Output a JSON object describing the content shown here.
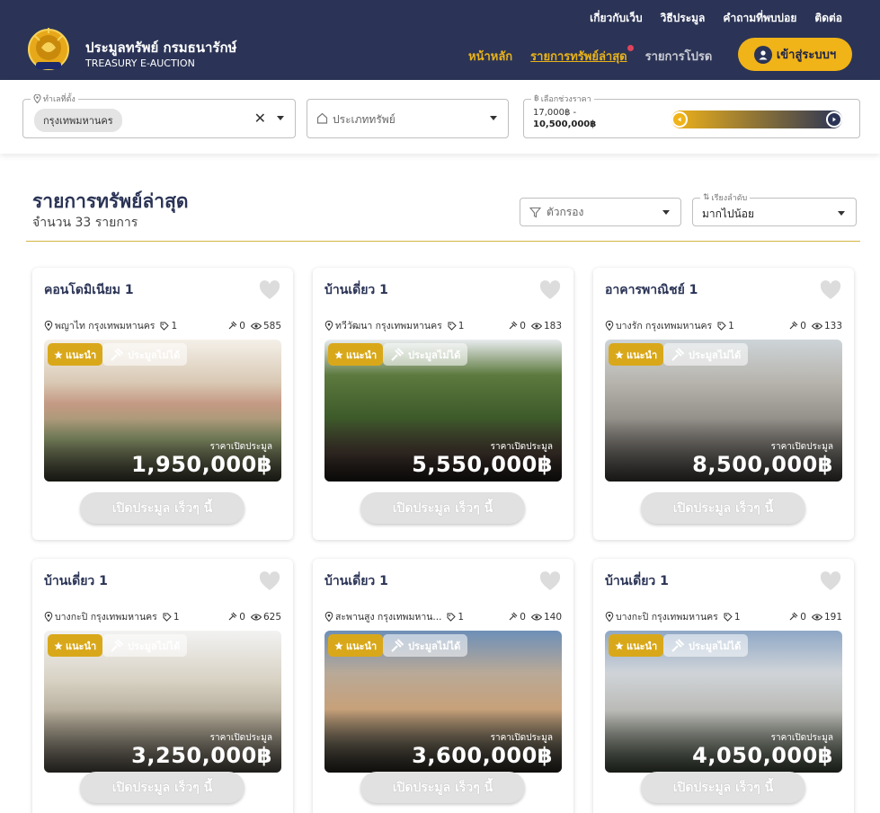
{
  "header": {
    "top_links": [
      "เกี่ยวกับเว็บ",
      "วิธีประมูล",
      "คำถามที่พบบ่อย",
      "ติดต่อ"
    ],
    "brand_th": "ประมูลทรัพย์ กรมธนารักษ์",
    "brand_en": "TREASURY E-AUCTION",
    "nav": {
      "home": "หน้าหลัก",
      "latest": "รายการทรัพย์ล่าสุด",
      "promo": "รายการโปรด"
    },
    "login_label": "เข้าสู่ระบบฯ"
  },
  "filters": {
    "location_legend": "ทำเลที่ตั้ง",
    "location_chip": "กรุงเทพมหานคร",
    "type_placeholder": "ประเภททรัพย์",
    "price_legend": "เลือกช่วงราคา",
    "price_min": "17,000฿ -",
    "price_max": "10,500,000฿"
  },
  "section": {
    "title": "รายการทรัพย์ล่าสุด",
    "count": "จำนวน 33 รายการ",
    "filter_label": "ตัวกรอง",
    "sort_legend": "เรียงลำดับ",
    "sort_value": "มากไปน้อย"
  },
  "badges": {
    "recommended": "แนะนำ",
    "biddable": "ประมูลไม่ได้",
    "price_label": "ราคาเปิดประมูล",
    "cta": "เปิดประมูล เร็วๆ นี้"
  },
  "listings": [
    {
      "title": "คอนโดมิเนียม 1",
      "location": "พญาไท กรุงเทพมหานคร",
      "tag": "1",
      "bids": "0",
      "views": "585",
      "price": "1,950,000฿"
    },
    {
      "title": "บ้านเดี่ยว 1",
      "location": "ทวีวัฒนา กรุงเทพมหานคร",
      "tag": "1",
      "bids": "0",
      "views": "183",
      "price": "5,550,000฿"
    },
    {
      "title": "อาคารพาณิชย์ 1",
      "location": "บางรัก กรุงเทพมหานคร",
      "tag": "1",
      "bids": "0",
      "views": "133",
      "price": "8,500,000฿"
    },
    {
      "title": "บ้านเดี่ยว 1",
      "location": "บางกะปิ กรุงเทพมหานคร",
      "tag": "1",
      "bids": "0",
      "views": "625",
      "price": "3,250,000฿"
    },
    {
      "title": "บ้านเดี่ยว 1",
      "location": "สะพานสูง กรุงเทพมหาน...",
      "tag": "1",
      "bids": "0",
      "views": "140",
      "price": "3,600,000฿"
    },
    {
      "title": "บ้านเดี่ยว 1",
      "location": "บางกะปิ กรุงเทพมหานคร",
      "tag": "1",
      "bids": "0",
      "views": "191",
      "price": "4,050,000฿"
    }
  ]
}
